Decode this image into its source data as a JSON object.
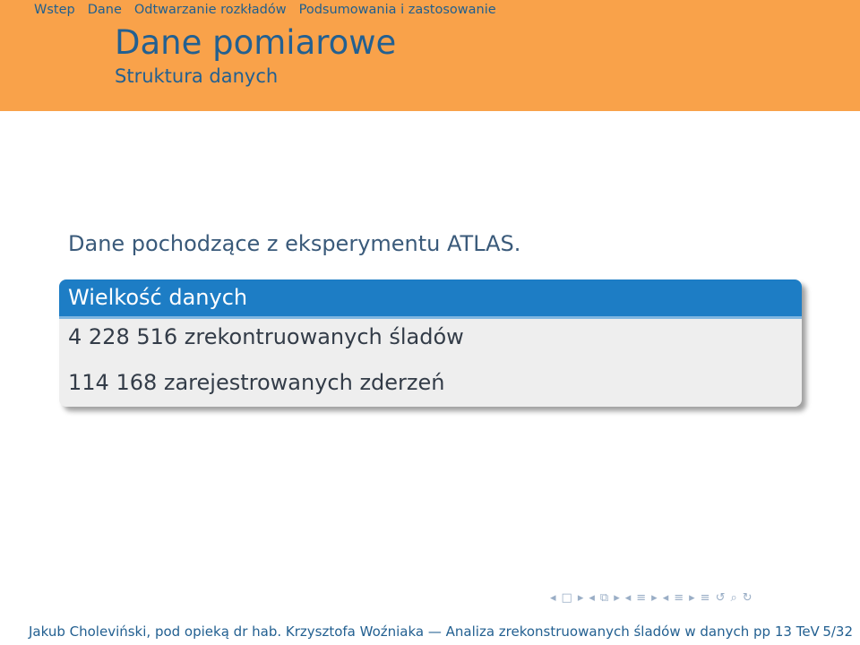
{
  "header": {
    "nav": [
      "Wstep",
      "Dane",
      "Odtwarzanie rozkładów",
      "Podsumowania i zastosowanie"
    ],
    "title": "Dane pomiarowe",
    "subtitle": "Struktura danych"
  },
  "content": {
    "intro": "Dane pochodzące z eksperymentu ATLAS.",
    "block": {
      "title": "Wielkość danych",
      "lines": [
        "4 228 516 zrekontruowanych śladów",
        "114 168 zarejestrowanych zderzeń"
      ]
    }
  },
  "navigation_symbols": [
    "◂",
    "□",
    "▸",
    "◂",
    "⧉",
    "▸",
    "◂",
    "≡",
    "▸",
    "◂",
    "≡",
    "▸",
    "≡",
    "↺",
    "⌕",
    "↻"
  ],
  "footer": {
    "author": "Jakub Choleviński, pod opieką dr hab. Krzysztofa Woźniaka — Analiza zrekonstruowanych śladów w danych pp 13 TeV",
    "page": "5/32"
  },
  "colors": {
    "header_bg": "#f9a24a",
    "title": "#236091",
    "block_title_bg": "#1d7dc5",
    "block_body_bg": "#eeeeee"
  }
}
